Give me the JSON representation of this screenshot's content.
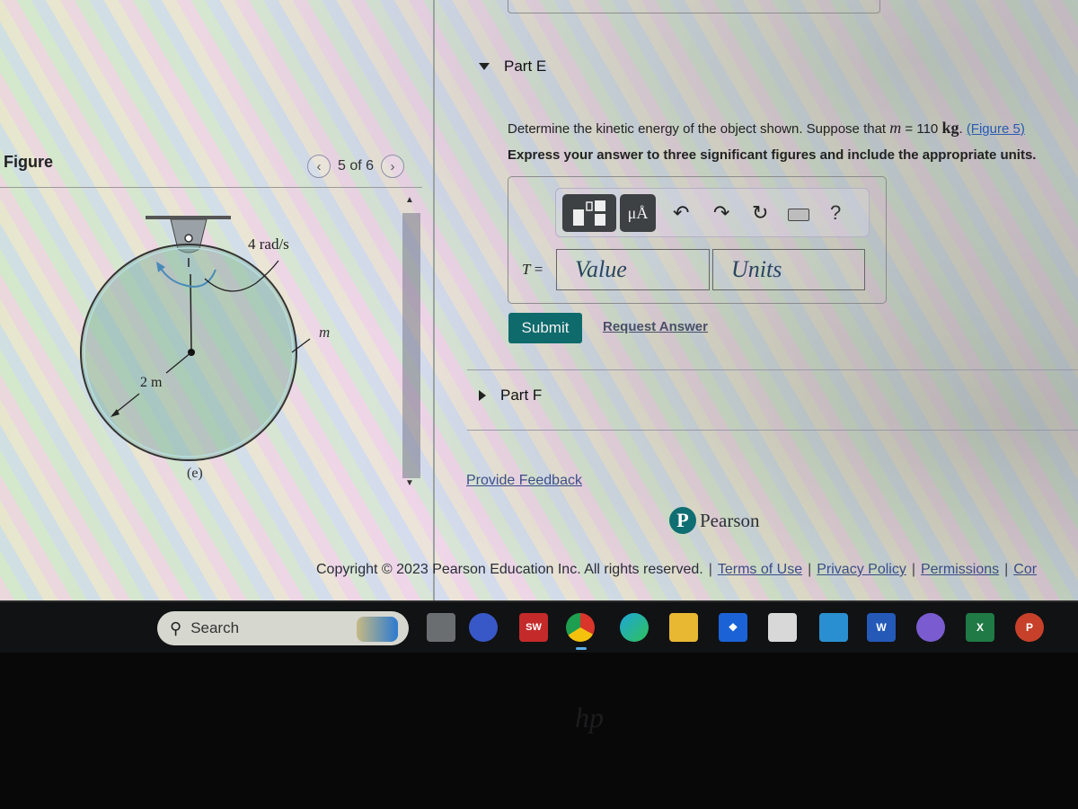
{
  "figure_panel": {
    "title": "Figure",
    "counter": "5 of 6",
    "prev_icon": "chevron-left-icon",
    "next_icon": "chevron-right-icon",
    "diagram": {
      "angular_velocity_label": "4 rad/s",
      "mass_label": "m",
      "radius_label": "2 m",
      "caption": "(e)"
    }
  },
  "problem": {
    "part_e": {
      "label": "Part E",
      "expanded": true,
      "question_prefix": "Determine the kinetic energy of the object shown. Suppose that ",
      "var": "m",
      "equals": " = 110 ",
      "unit": "kg",
      "figure_link": "(Figure 5)",
      "instruction": "Express your answer to three significant figures and include the appropriate units.",
      "toolbar": {
        "templates_icon": "templates-icon",
        "units_button": "μÅ",
        "undo_icon": "undo-icon",
        "redo_icon": "redo-icon",
        "reset_icon": "reset-icon",
        "keyboard_icon": "keyboard-icon",
        "help": "?"
      },
      "answer_var": "T",
      "answer_eq": " =",
      "value_placeholder": "Value",
      "units_placeholder": "Units",
      "submit_label": "Submit",
      "request_answer_label": "Request Answer"
    },
    "part_f": {
      "label": "Part F",
      "expanded": false
    },
    "feedback_label": "Provide Feedback"
  },
  "footer": {
    "brand": "Pearson",
    "brand_initial": "P",
    "copyright": "Copyright © 2023 Pearson Education Inc. All rights reserved.",
    "links": [
      "Terms of Use",
      "Privacy Policy",
      "Permissions",
      "Cor"
    ]
  },
  "taskbar": {
    "search_label": "Search",
    "apps": [
      {
        "name": "task-view",
        "label": ""
      },
      {
        "name": "meet",
        "label": ""
      },
      {
        "name": "solidworks",
        "label": "SW"
      },
      {
        "name": "chrome",
        "label": ""
      },
      {
        "name": "edge",
        "label": ""
      },
      {
        "name": "file-explorer",
        "label": ""
      },
      {
        "name": "dropbox",
        "label": ""
      },
      {
        "name": "microsoft-store",
        "label": ""
      },
      {
        "name": "mail",
        "label": ""
      },
      {
        "name": "word",
        "label": "W"
      },
      {
        "name": "copilot",
        "label": ""
      },
      {
        "name": "excel",
        "label": "X"
      },
      {
        "name": "powerpoint",
        "label": "P"
      }
    ]
  },
  "colors": {
    "submit": "#0f6a6c",
    "pearson": "#0f6e72",
    "link": "#3a4d86"
  }
}
